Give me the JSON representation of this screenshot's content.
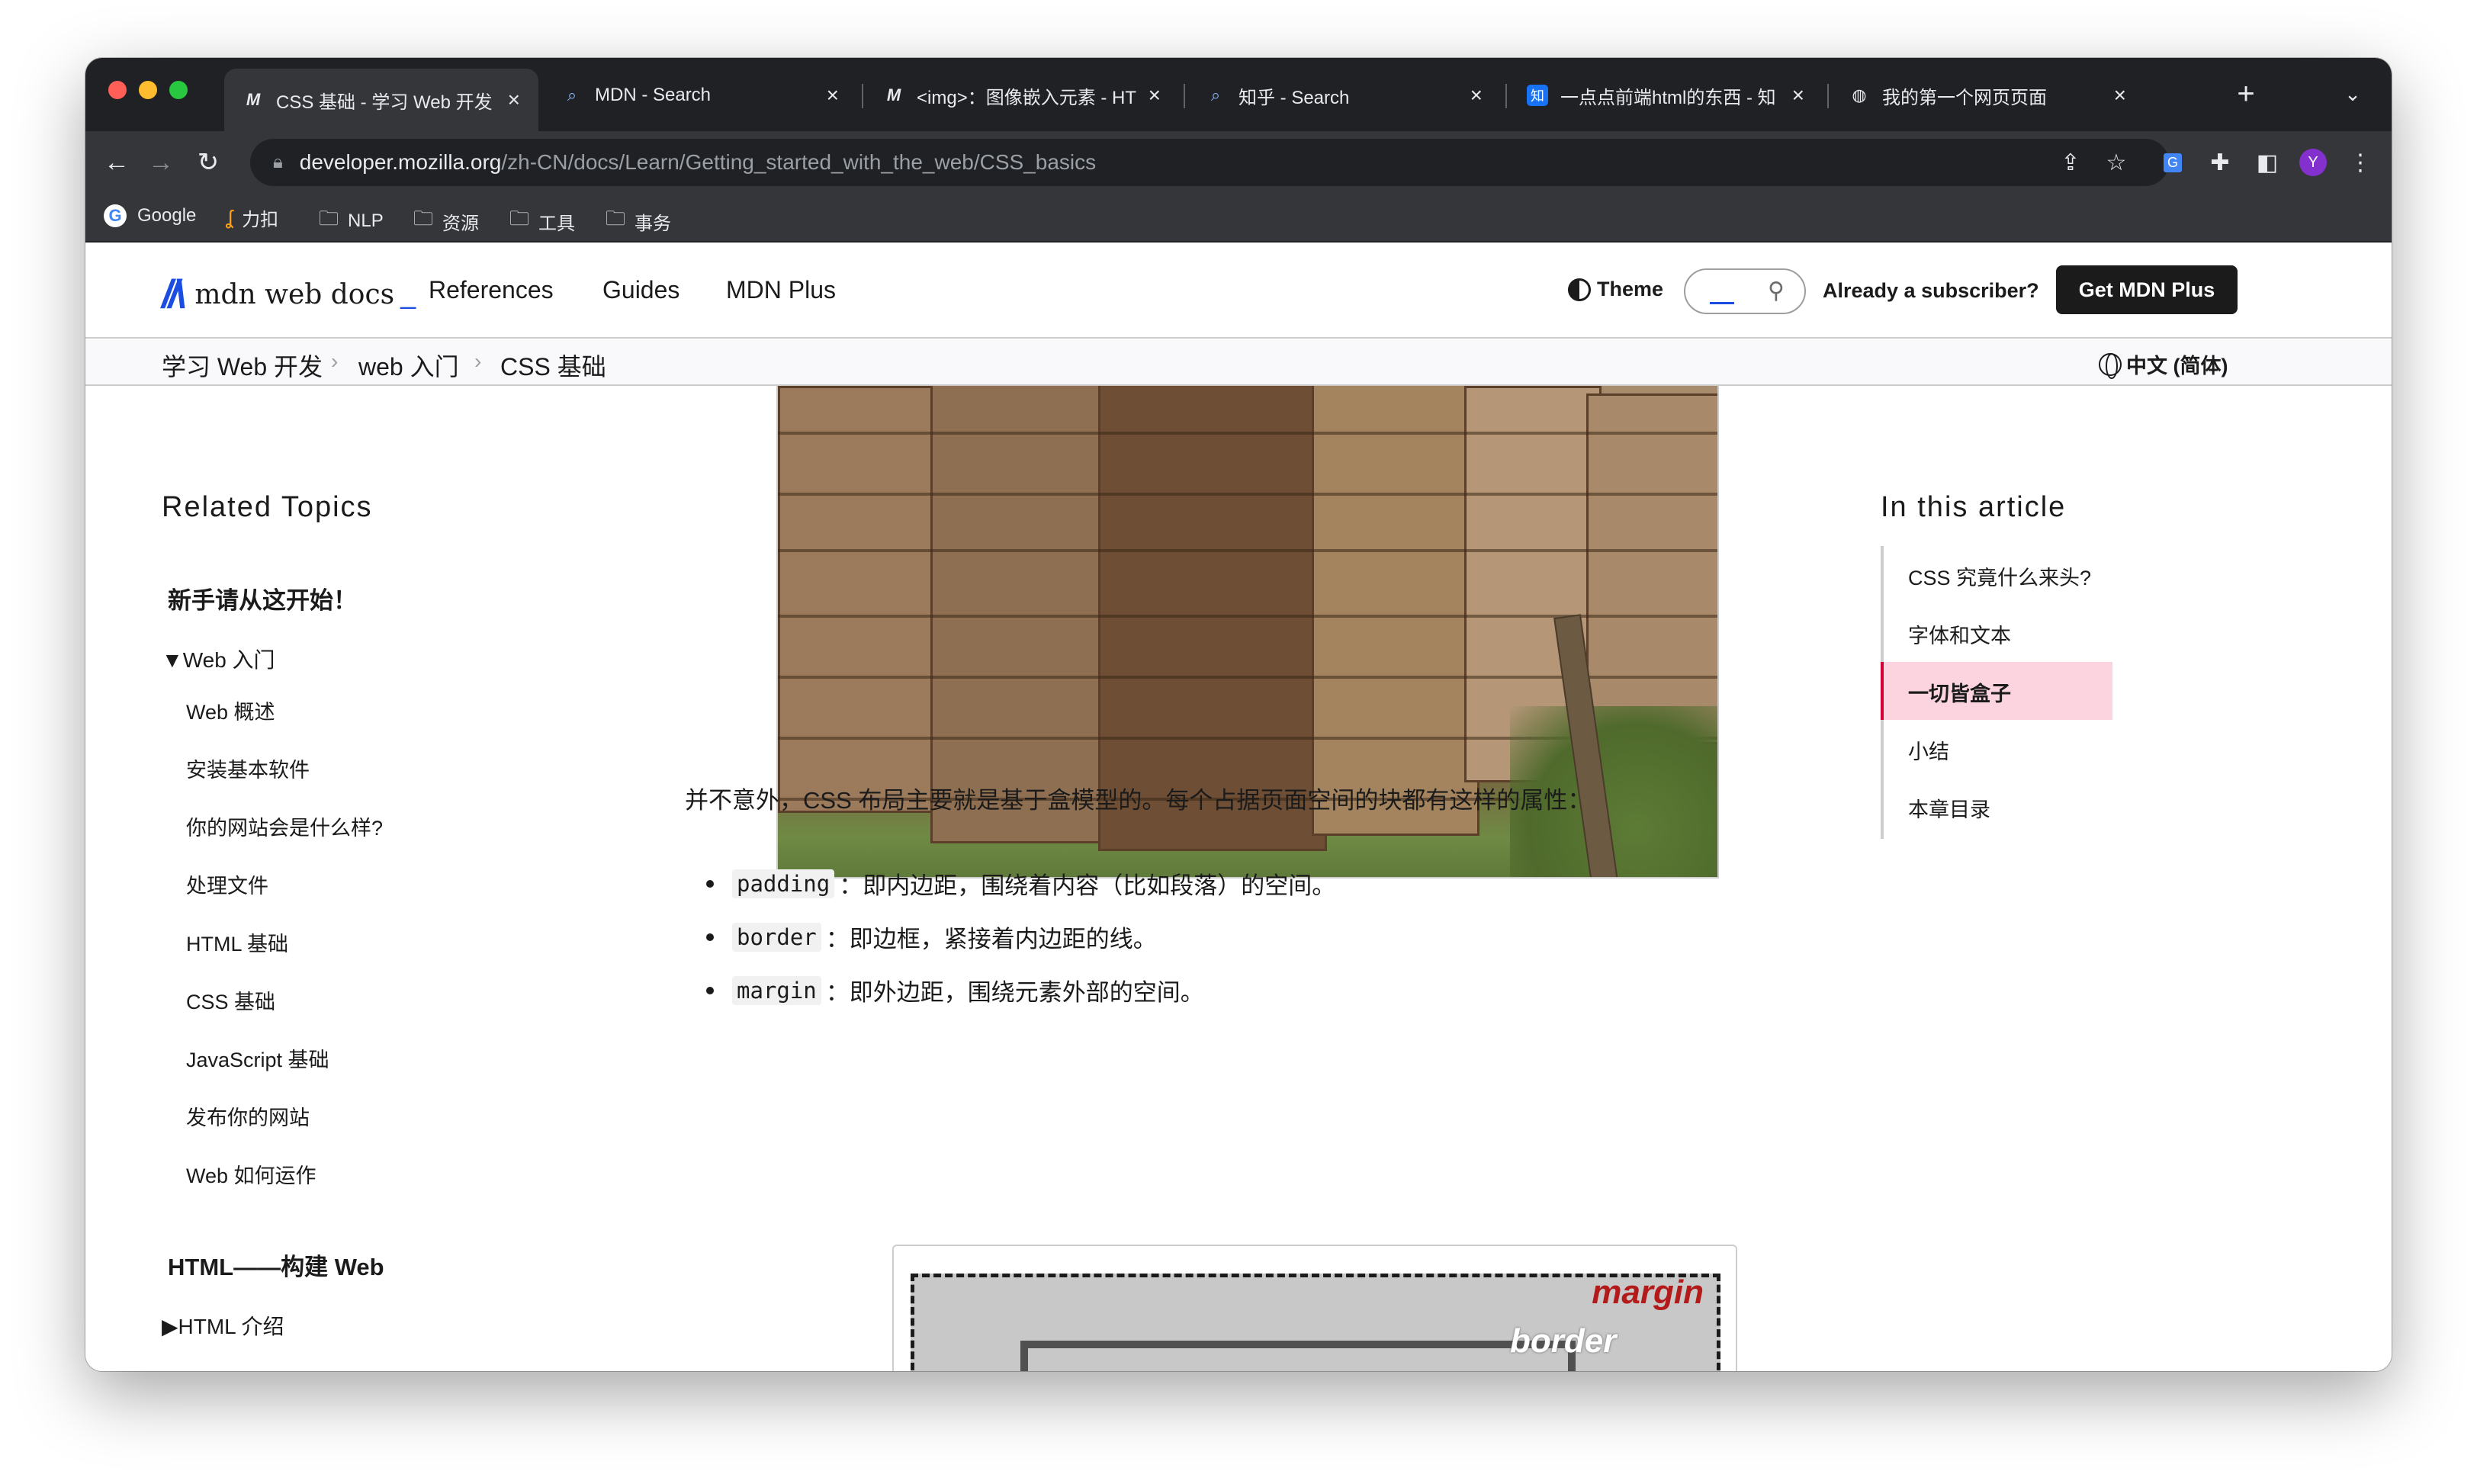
{
  "tabs": [
    {
      "label": "CSS 基础 - 学习 Web 开发 |",
      "icon": "mdn-icon"
    },
    {
      "label": "MDN - Search",
      "icon": "search-icon"
    },
    {
      "label": "<img>：图像嵌入元素 - HT",
      "icon": "mdn-icon"
    },
    {
      "label": "知乎 - Search",
      "icon": "search-icon"
    },
    {
      "label": "一点点前端html的东西 - 知",
      "icon": "zhihu-icon"
    },
    {
      "label": "我的第一个网页页面",
      "icon": "globe-icon"
    }
  ],
  "zhihu_icon_text": "知",
  "omnibox": {
    "host": "developer.mozilla.org",
    "path": "/zh-CN/docs/Learn/Getting_started_with_the_web/CSS_basics"
  },
  "profile_initial": "Y",
  "bookmarks": [
    {
      "label": "Google",
      "icon": "google-icon"
    },
    {
      "label": "力扣",
      "icon": "leetcode-icon"
    },
    {
      "label": "NLP",
      "icon": "folder-icon"
    },
    {
      "label": "资源",
      "icon": "folder-icon"
    },
    {
      "label": "工具",
      "icon": "folder-icon"
    },
    {
      "label": "事务",
      "icon": "folder-icon"
    }
  ],
  "mdn": {
    "logo_text": "mdn web docs",
    "logo_underscore": "_",
    "nav": [
      "References",
      "Guides",
      "MDN Plus"
    ],
    "theme": "Theme",
    "subscriber": "Already a subscriber?",
    "get_plus": "Get MDN Plus",
    "language": "中文 (简体)"
  },
  "breadcrumbs": [
    "学习 Web 开发",
    "web 入门",
    "CSS 基础"
  ],
  "sidebar": {
    "title": "Related Topics",
    "heading1": "新手请从这开始！",
    "toggle1": "▼Web 入门",
    "items": [
      "Web 概述",
      "安装基本软件",
      "你的网站会是什么样?",
      "处理文件",
      "HTML 基础",
      "CSS 基础",
      "JavaScript 基础",
      "发布你的网站",
      "Web 如何运作"
    ],
    "heading2": "HTML——构建 Web",
    "toggle2": "▶HTML 介绍"
  },
  "content": {
    "paragraph": "并不意外，CSS 布局主要就是基于盒模型的。每个占据页面空间的块都有这样的属性：",
    "bullets": [
      {
        "code": "padding",
        "text": "：即内边距，围绕着内容（比如段落）的空间。"
      },
      {
        "code": "border",
        "text": "：即边框，紧接着内边距的线。"
      },
      {
        "code": "margin",
        "text": "：即外边距，围绕元素外部的空间。"
      }
    ],
    "figure_labels": {
      "margin": "margin",
      "border": "border"
    }
  },
  "toc": {
    "title": "In this article",
    "items": [
      "CSS 究竟什么来头?",
      "字体和文本",
      "一切皆盒子",
      "小结",
      "本章目录"
    ],
    "active": "一切皆盒子"
  },
  "colors": {
    "mdn_blue": "#1b4ee0",
    "toc_active_bg": "#fcd4e0",
    "toc_active_border": "#d30038"
  }
}
